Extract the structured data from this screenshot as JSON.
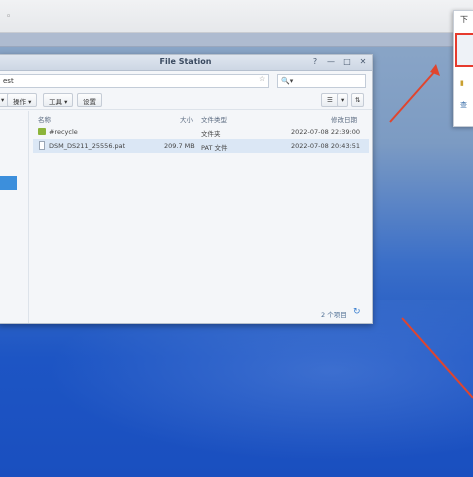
{
  "app": {
    "window_title": "File Station",
    "help_icon": "?",
    "minimize_icon": "—",
    "maximize_icon": "□",
    "close_icon": "✕"
  },
  "address": {
    "path_value": "est",
    "favorite_icon": "☆",
    "search_placeholder": "🔍▾"
  },
  "toolbar": {
    "button1": "▾",
    "button2": "操作 ▾",
    "button3": "工具 ▾",
    "button4": "设置",
    "view_list": "☰",
    "view_dropdown": "▾",
    "sort": "⇅"
  },
  "columns": {
    "name": "名称",
    "size": "大小",
    "type": "文件类型",
    "modified": "修改日期"
  },
  "files": [
    {
      "name": "#recycle",
      "size": "",
      "type": "文件夹",
      "modified": "2022-07-08 22:39:00",
      "selected": false,
      "kind": "folder"
    },
    {
      "name": "DSM_DS211_25556.pat",
      "size": "209.7 MB",
      "type": "PAT 文件",
      "modified": "2022-07-08 20:43:51",
      "selected": true,
      "kind": "file"
    }
  ],
  "footer": {
    "count_label": "2 个项目",
    "refresh_icon": "↻"
  },
  "dropdown_menu": {
    "title": "下",
    "item2": "▮",
    "item3": "查"
  },
  "colors": {
    "highlight_red": "#e63b2e",
    "selected_row": "#dbe7f5",
    "desktop_blue": "#1d55c4"
  }
}
